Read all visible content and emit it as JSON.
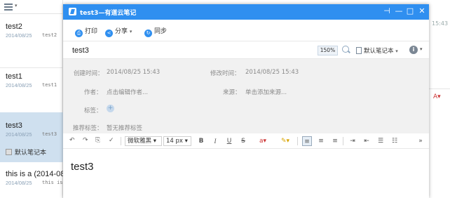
{
  "background": {
    "notes": [
      {
        "title": "test2",
        "date": "2014/08/25",
        "preview": "test2"
      },
      {
        "title": "test1",
        "date": "2014/08/25",
        "preview": "test1"
      },
      {
        "title": "test3",
        "date": "2014/08/25",
        "preview": "test3",
        "notebook": "默认笔记本"
      },
      {
        "title": "this is a (2014-08",
        "date": "2014/08/25",
        "preview": "this is"
      }
    ],
    "right_time": "15:43",
    "colors": {
      "selected_bg": "#cfe0ef",
      "date": "#8aa0b6"
    }
  },
  "window": {
    "title": "test3—有道云笔记",
    "controls": {
      "pin": "⊣",
      "minimize": "—",
      "maximize": "□",
      "close": "✕"
    },
    "actions": {
      "print": "打印",
      "share": "分享",
      "sync": "同步"
    },
    "note_name": "test3",
    "zoom": "150%",
    "notebook": "默认笔记本",
    "meta": {
      "created_label": "创建时间：",
      "created_value": "2014/08/25 15:43",
      "modified_label": "修改时间：",
      "modified_value": "2014/08/25 15:43",
      "author_label": "作者：",
      "author_value": "点击编辑作者...",
      "source_label": "来源：",
      "source_value": "单击添加来源...",
      "tags_label": "标签：",
      "recommended_label": "推荐标签：",
      "recommended_value": "暂无推荐标签"
    },
    "format": {
      "font": "微软雅黑",
      "size": "14 px",
      "bold": "B",
      "italic": "I",
      "underline": "U",
      "strike": "S"
    },
    "content": "test3",
    "colors": {
      "titlebar": "#2f8ff0",
      "meta_bg": "#f1f1f1"
    }
  }
}
